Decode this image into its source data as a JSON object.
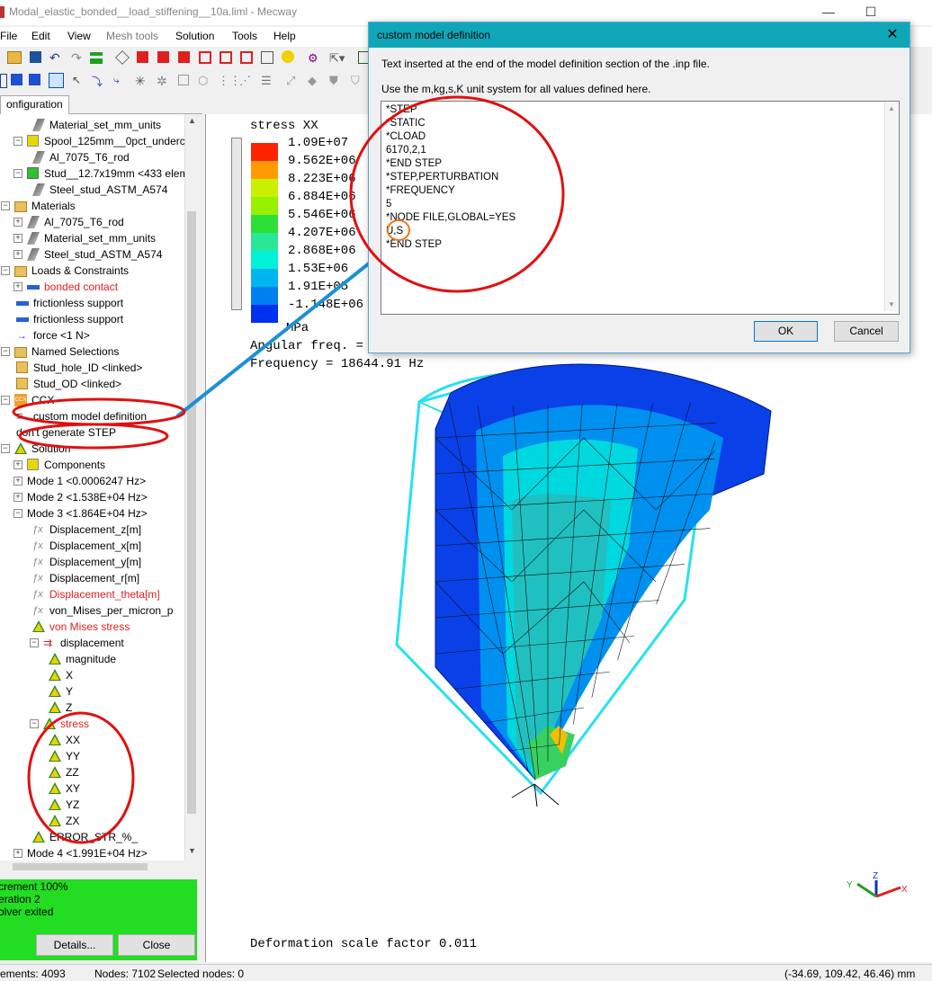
{
  "window": {
    "title": "Modal_elastic_bonded__load_stiffening__10a.liml - Mecway",
    "minimize": "—",
    "maximize": "☐",
    "close": "✕"
  },
  "menu": [
    "File",
    "Edit",
    "View",
    "Mesh tools",
    "Solution",
    "Tools",
    "Help"
  ],
  "tab_label": "onfiguration",
  "tree": [
    {
      "label": "Material_set_mm_units",
      "red": false
    },
    {
      "label": "Spool_125mm__0pct_undercu",
      "red": false
    },
    {
      "label": "Al_7075_T6_rod",
      "red": false
    },
    {
      "label": "Stud__12.7x19mm <433 elem",
      "red": false
    },
    {
      "label": "Steel_stud_ASTM_A574",
      "red": false
    },
    {
      "label": "Materials",
      "red": false
    },
    {
      "label": "Al_7075_T6_rod",
      "red": false
    },
    {
      "label": "Material_set_mm_units",
      "red": false
    },
    {
      "label": "Steel_stud_ASTM_A574",
      "red": false
    },
    {
      "label": "Loads & Constraints",
      "red": false
    },
    {
      "label": "bonded contact",
      "red": true
    },
    {
      "label": "frictionless support",
      "red": false
    },
    {
      "label": "frictionless support",
      "red": false
    },
    {
      "label": "force <1 N>",
      "red": false
    },
    {
      "label": "Named Selections",
      "red": false
    },
    {
      "label": "Stud_hole_ID <linked>",
      "red": false
    },
    {
      "label": "Stud_OD <linked>",
      "red": false
    },
    {
      "label": "CCX",
      "red": false
    },
    {
      "label": "custom model definition",
      "red": false
    },
    {
      "label": "don't generate STEP",
      "red": false
    },
    {
      "label": "Solution",
      "red": false
    },
    {
      "label": "Components",
      "red": false
    },
    {
      "label": "Mode 1 <0.0006247 Hz>",
      "red": false
    },
    {
      "label": "Mode 2 <1.538E+04 Hz>",
      "red": false
    },
    {
      "label": "Mode 3 <1.864E+04 Hz>",
      "red": false
    },
    {
      "label": "Displacement_z[m]",
      "red": false
    },
    {
      "label": "Displacement_x[m]",
      "red": false
    },
    {
      "label": "Displacement_y[m]",
      "red": false
    },
    {
      "label": "Displacement_r[m]",
      "red": false
    },
    {
      "label": "Displacement_theta[m]",
      "red": true
    },
    {
      "label": "von_Mises_per_micron_p",
      "red": false
    },
    {
      "label": "von Mises stress",
      "red": true
    },
    {
      "label": "displacement",
      "red": false
    },
    {
      "label": "magnitude",
      "red": false
    },
    {
      "label": "X",
      "red": false
    },
    {
      "label": "Y",
      "red": false
    },
    {
      "label": "Z",
      "red": false
    },
    {
      "label": "stress",
      "red": true
    },
    {
      "label": "XX",
      "red": false
    },
    {
      "label": "YY",
      "red": false
    },
    {
      "label": "ZZ",
      "red": false
    },
    {
      "label": "XY",
      "red": false
    },
    {
      "label": "YZ",
      "red": false
    },
    {
      "label": "ZX",
      "red": false
    },
    {
      "label": "ERROR_STR_%_",
      "red": false
    },
    {
      "label": "Mode 4 <1.991E+04 Hz>",
      "red": false
    }
  ],
  "solver_status": {
    "lines": [
      "crement 100%",
      "eration 2",
      "olver exited"
    ],
    "details_button": "Details...",
    "close_button": "Close"
  },
  "view": {
    "legend_title": "stress XX",
    "legend_values": [
      "1.09E+07",
      "9.562E+06",
      "8.223E+06",
      "6.884E+06",
      "5.546E+06",
      "4.207E+06",
      "2.868E+06",
      "1.53E+06",
      "1.91E+05",
      "-1.148E+06"
    ],
    "legend_colors": [
      "#ff2400",
      "#ff9a00",
      "#c8f000",
      "#96f000",
      "#2ce038",
      "#28e898",
      "#00f0d8",
      "#00b4f0",
      "#0080f0",
      "#0030f0"
    ],
    "unit": "MPa",
    "angular_freq": "Angular freq. =",
    "frequency": "Frequency = 18644.91 Hz",
    "deformation_scale": "Deformation scale factor 0.011"
  },
  "dialog": {
    "title": "custom model definition",
    "desc1": "Text inserted at the end of the model definition section of the .inp file.",
    "desc2": "Use the m,kg,s,K unit system for all values defined here.",
    "code_lines": [
      "*STEP",
      "*STATIC",
      "*CLOAD",
      "6170,2,1",
      "*END STEP",
      "*STEP,PERTURBATION",
      "*FREQUENCY",
      "5",
      "*NODE FILE,GLOBAL=YES",
      "U,S",
      "*END STEP"
    ],
    "ok": "OK",
    "cancel": "Cancel"
  },
  "statusbar": {
    "elements": "ements: 4093",
    "nodes": "Nodes: 7102",
    "selected": "Selected nodes: 0",
    "coords": "(-34.69, 109.42, 46.46) mm"
  }
}
